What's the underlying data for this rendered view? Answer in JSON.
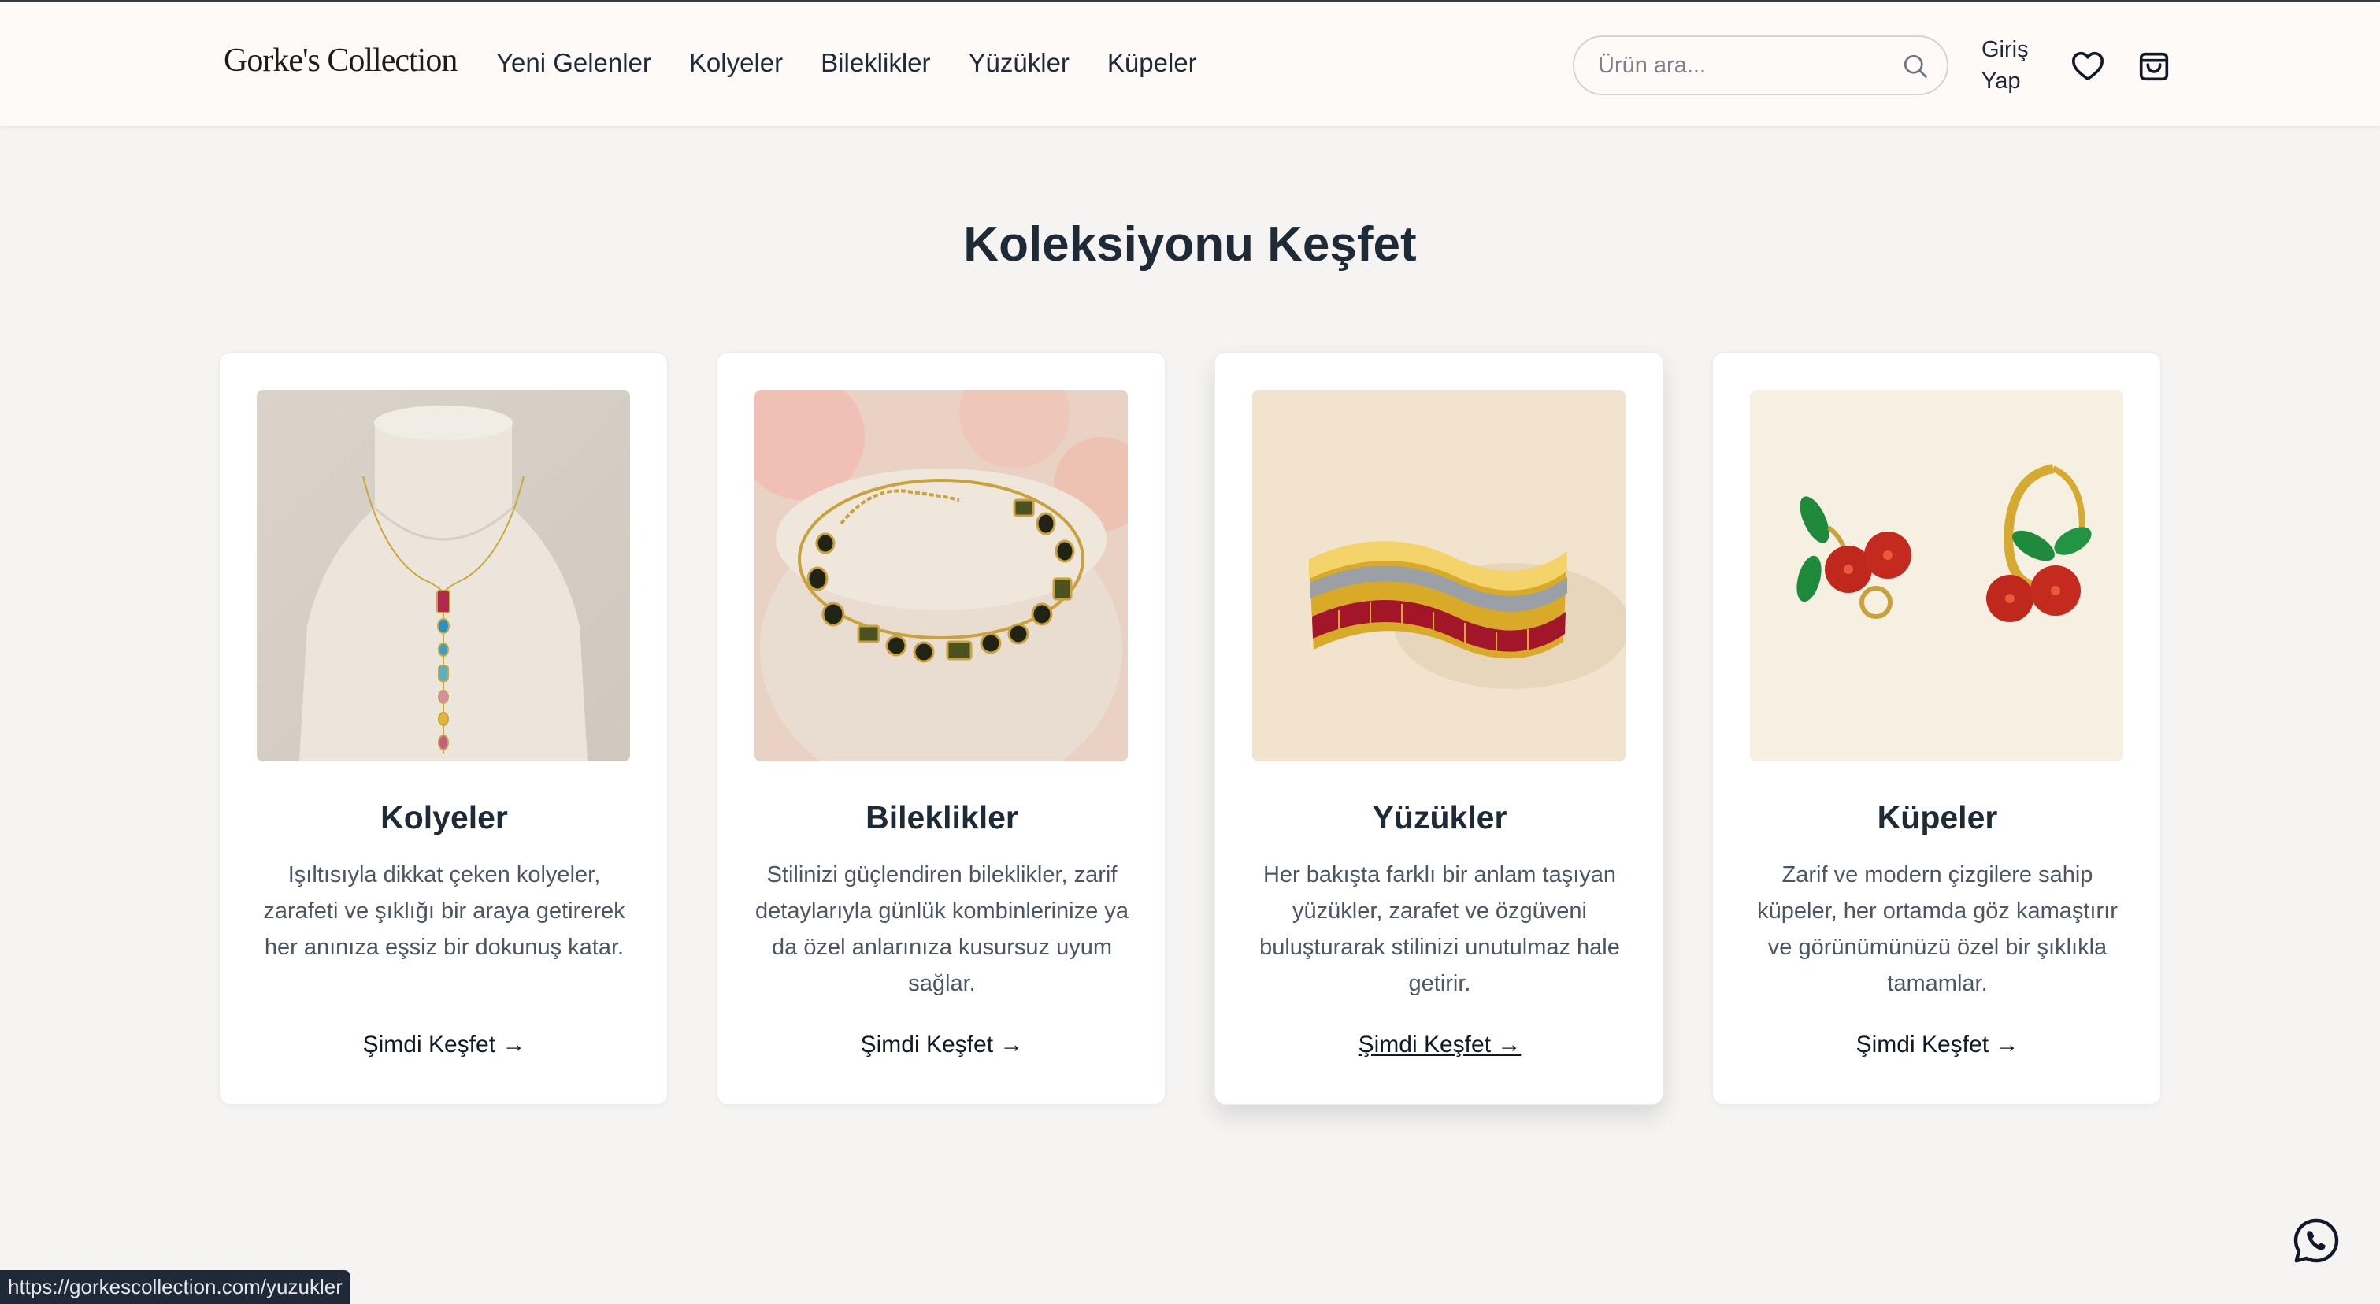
{
  "header": {
    "logo": "Gorke's Collection",
    "nav": [
      "Yeni Gelenler",
      "Kolyeler",
      "Bileklikler",
      "Yüzükler",
      "Küpeler"
    ],
    "search_placeholder": "Ürün ara...",
    "login": "Giriş Yap",
    "icons": [
      "search-icon",
      "heart-icon",
      "shopping-bag-icon"
    ]
  },
  "main": {
    "title": "Koleksiyonu Keşfet",
    "cards": [
      {
        "title": "Kolyeler",
        "description": "Işıltısıyla dikkat çeken kolyeler, zarafeti ve şıklığı bir araya getirerek her anınıza eşsiz bir dokunuş katar.",
        "cta": "Şimdi Keşfet →"
      },
      {
        "title": "Bileklikler",
        "description": "Stilinizi güçlendiren bileklikler, zarif detaylarıyla günlük kombinlerinize ya da özel anlarınıza kusursuz uyum sağlar.",
        "cta": "Şimdi Keşfet →"
      },
      {
        "title": "Yüzükler",
        "description": "Her bakışta farklı bir anlam taşıyan yüzükler, zarafet ve özgüveni buluşturarak stilinizi unutulmaz hale getirir.",
        "cta": "Şimdi Keşfet →"
      },
      {
        "title": "Küpeler",
        "description": "Zarif ve modern çizgilere sahip küpeler, her ortamda göz kamaştırır ve görünümünüzü özel bir şıklıkla tamamlar.",
        "cta": "Şimdi Keşfet →"
      }
    ]
  },
  "status_bar": {
    "url": "https://gorkescollection.com/yuzukler"
  },
  "floating": {
    "icon": "whatsapp-icon"
  },
  "colors": {
    "background": "#f5f4f2",
    "header_bg": "#fdfaf8",
    "title": "#1f2a37",
    "text_muted": "#4b5563"
  }
}
